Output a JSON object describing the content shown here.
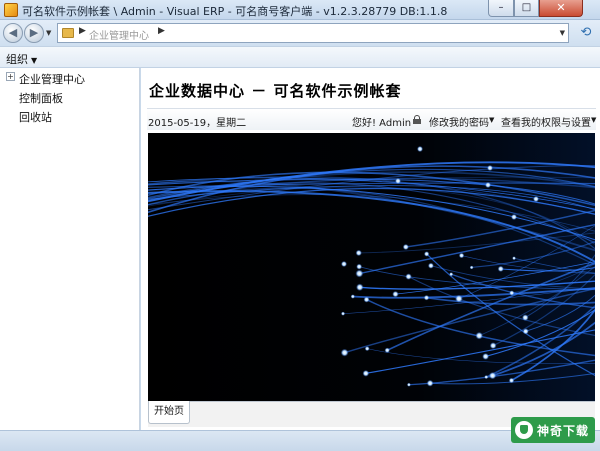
{
  "window": {
    "title": "可名软件示例帐套 \\ Admin - Visual ERP - 可名商号客户端 - v1.2.3.28779  DB:1.1.8",
    "min_glyph": "–",
    "max_glyph": "□",
    "close_glyph": "✕"
  },
  "address": {
    "back_glyph": "◀",
    "forward_glyph": "▶",
    "dropdown_glyph": "▼",
    "separator": "▶",
    "path": "企业管理中心",
    "refresh_glyph": "⟲"
  },
  "toolbar": {
    "organize_label": "组织",
    "caret": "▼"
  },
  "tree": {
    "expander": "+",
    "items": [
      {
        "label": "企业管理中心"
      },
      {
        "label": "控制面板"
      },
      {
        "label": "回收站"
      }
    ]
  },
  "main": {
    "page_title": "企业数据中心 － 可名软件示例帐套",
    "date": "2015-05-19，星期二",
    "greeting": "您好! Admin",
    "change_password": "修改我的密码",
    "view_permissions": "查看我的权限与设置",
    "dropdown_glyph": "▼"
  },
  "tabs": [
    {
      "label": "开始页"
    }
  ],
  "watermark": {
    "text": "神奇下载"
  },
  "colors": {
    "fiber_blue": "#2f7bff",
    "fiber_glow": "#cfe6ff",
    "watermark_green": "#2e9b4a"
  }
}
